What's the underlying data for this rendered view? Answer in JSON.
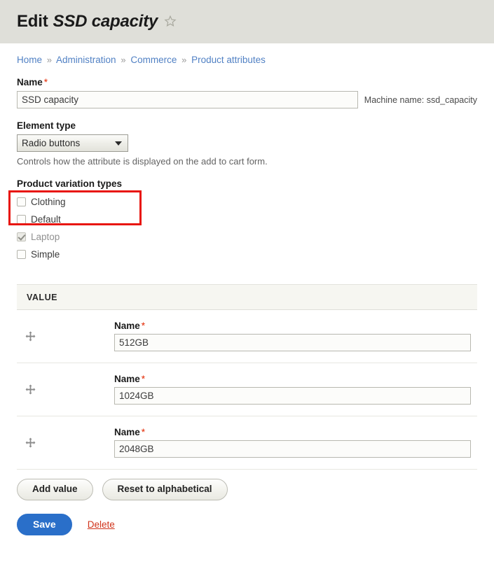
{
  "header": {
    "title_prefix": "Edit",
    "title_entity": "SSD capacity",
    "star_icon": "star-outline-icon",
    "background_color": "#dfdfd9"
  },
  "breadcrumb": {
    "separator": "»",
    "items": [
      {
        "label": "Home"
      },
      {
        "label": "Administration"
      },
      {
        "label": "Commerce"
      },
      {
        "label": "Product attributes"
      }
    ]
  },
  "form": {
    "name": {
      "label": "Name",
      "required_marker": "*",
      "value": "SSD capacity",
      "machine_name": "Machine name: ssd_capacity"
    },
    "element_type": {
      "label": "Element type",
      "selected": "Radio buttons",
      "help": "Controls how the attribute is displayed on the add to cart form.",
      "highlight_color": "#e8150e"
    },
    "product_variation_types": {
      "label": "Product variation types",
      "options": [
        {
          "label": "Clothing",
          "checked": false,
          "disabled": false
        },
        {
          "label": "Default",
          "checked": false,
          "disabled": false
        },
        {
          "label": "Laptop",
          "checked": true,
          "disabled": true
        },
        {
          "label": "Simple",
          "checked": false,
          "disabled": false
        }
      ]
    }
  },
  "value_table": {
    "column_header": "VALUE",
    "drag_icon": "move-cross-icon",
    "rows": [
      {
        "name_label": "Name",
        "required_marker": "*",
        "value": "512GB"
      },
      {
        "name_label": "Name",
        "required_marker": "*",
        "value": "1024GB"
      },
      {
        "name_label": "Name",
        "required_marker": "*",
        "value": "2048GB"
      }
    ],
    "actions": {
      "add_value": "Add value",
      "reset_alphabetical": "Reset to alphabetical"
    }
  },
  "footer": {
    "save": "Save",
    "delete": "Delete",
    "save_color": "#2a6fc9",
    "delete_color": "#d0341b"
  }
}
